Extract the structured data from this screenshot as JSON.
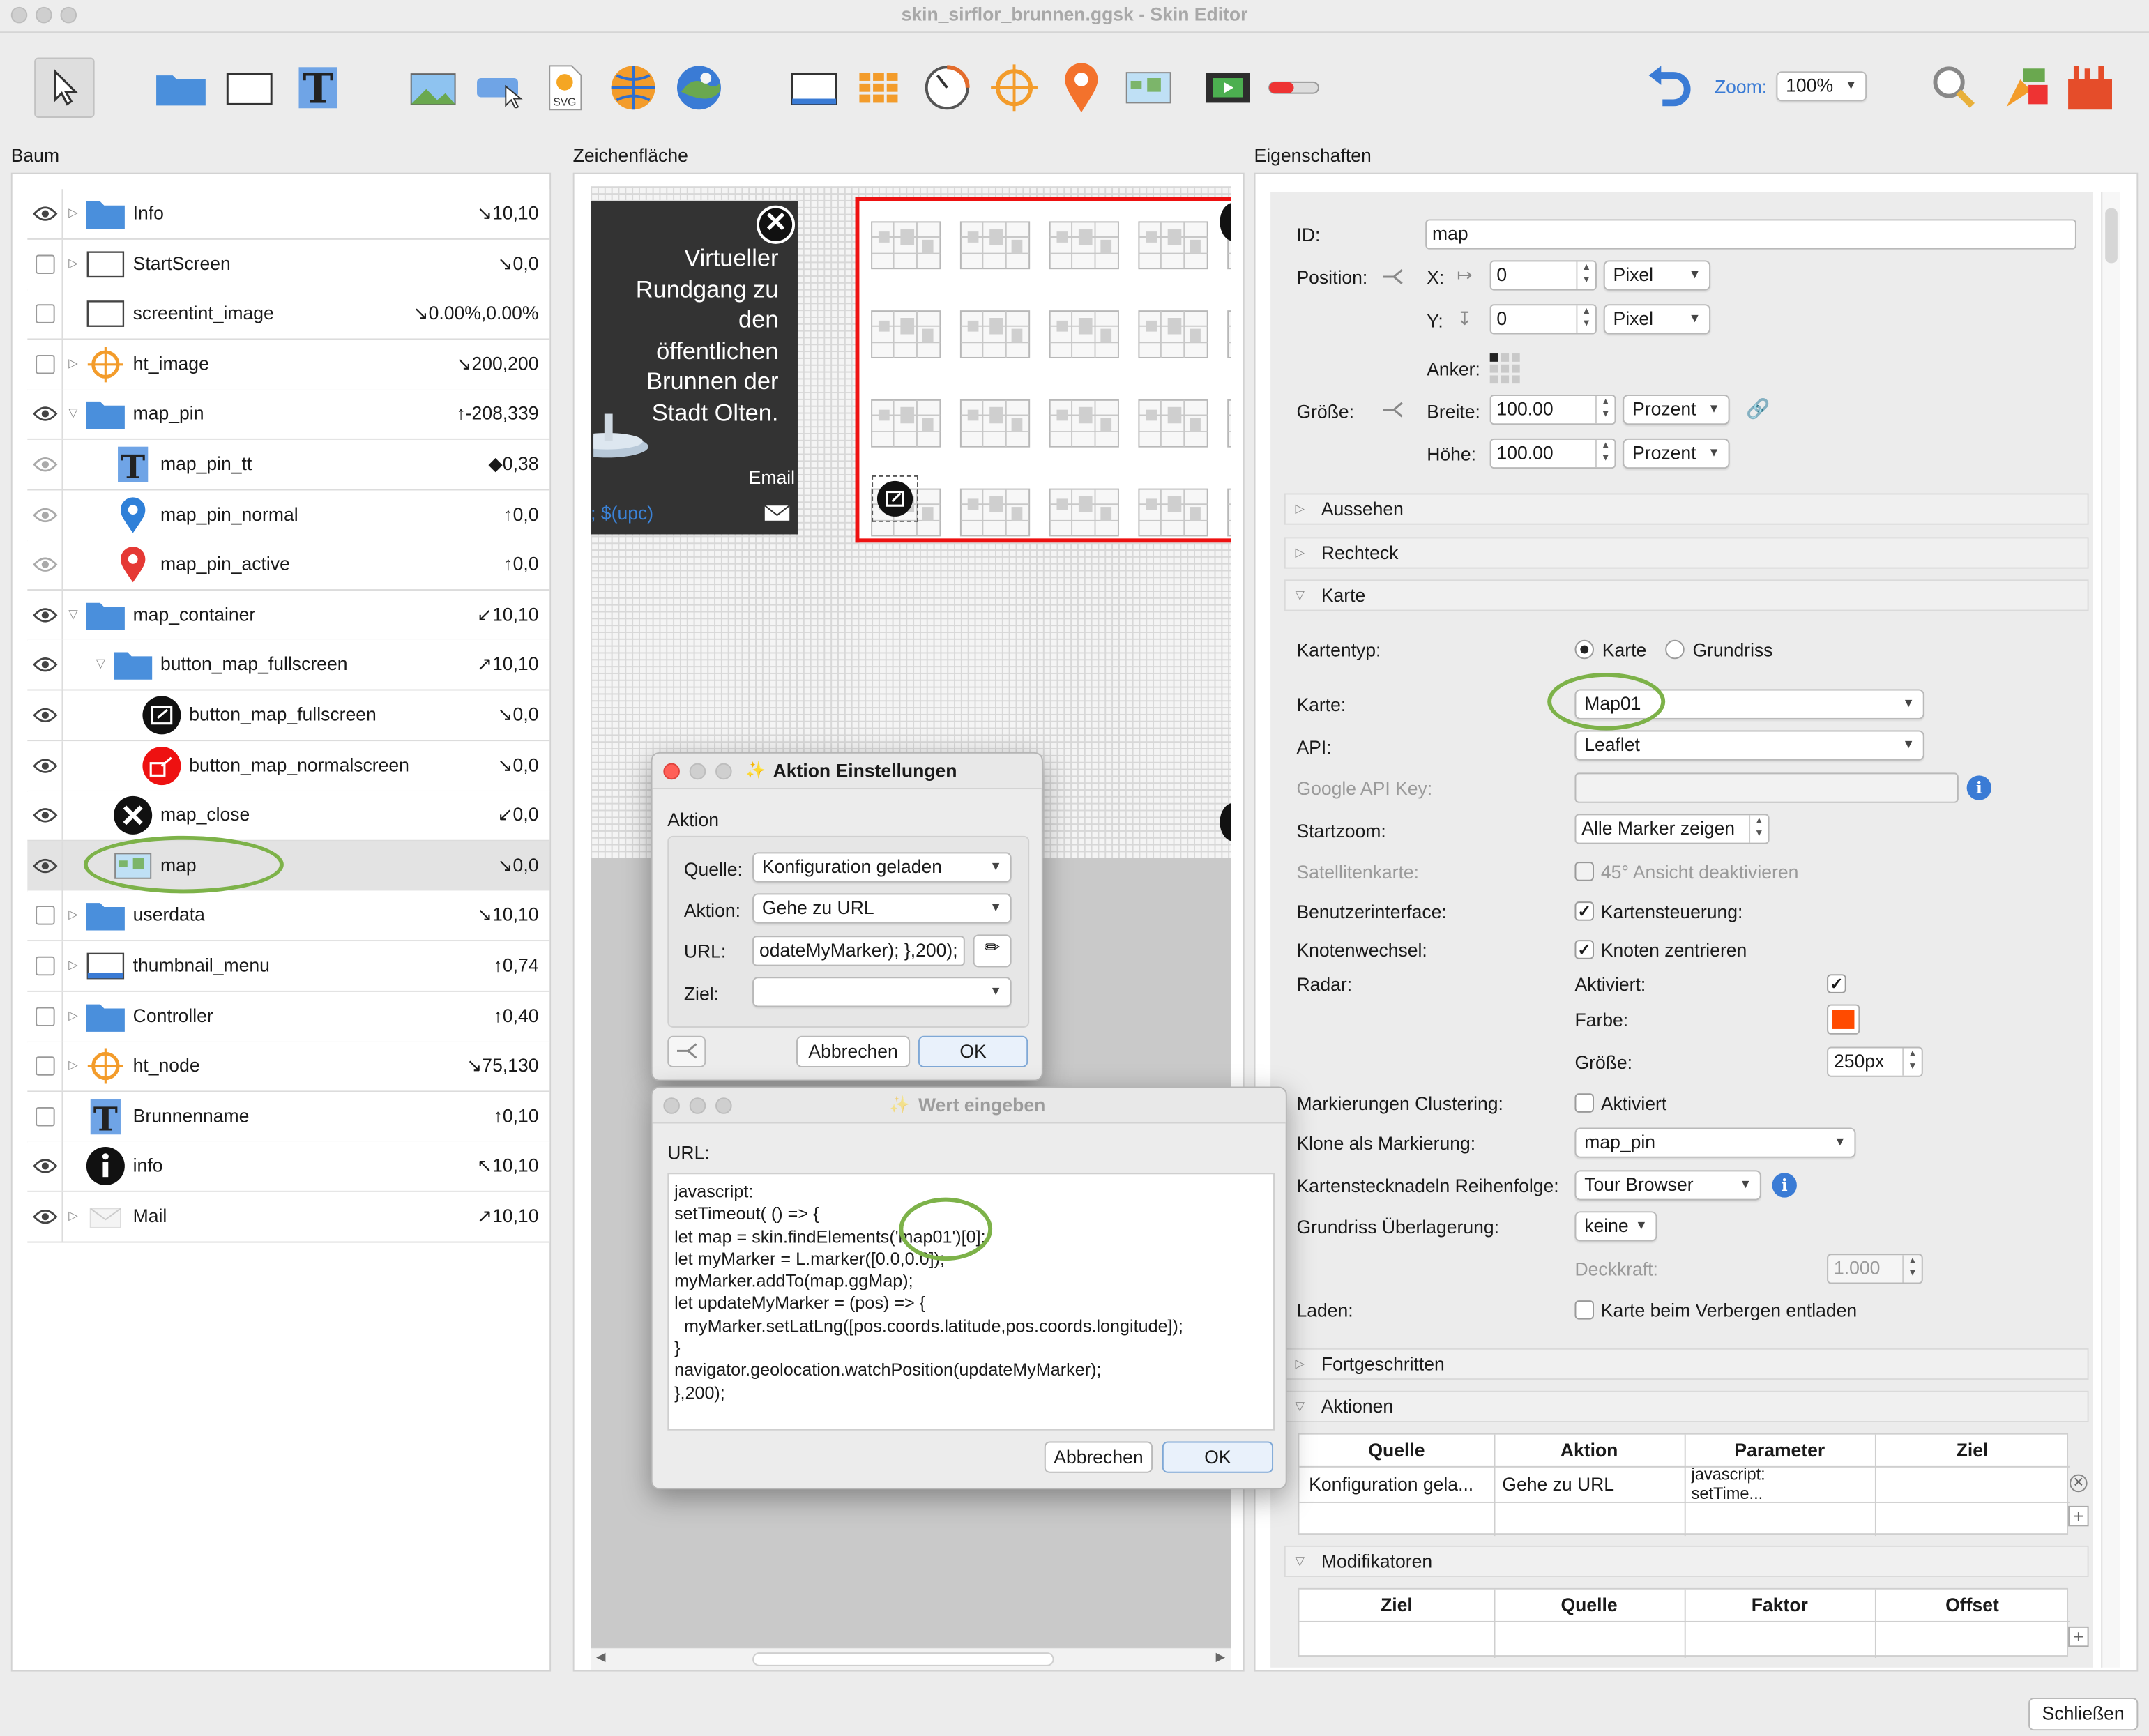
{
  "window": {
    "title": "skin_sirflor_brunnen.ggsk - Skin Editor"
  },
  "toolbar": {
    "zoom_label": "Zoom:",
    "zoom_value": "100%"
  },
  "panels": {
    "tree_title": "Baum",
    "canvas_title": "Zeichenfläche",
    "props_title": "Eigenschaften"
  },
  "tree": [
    {
      "label": "Info",
      "value": "↘10,10",
      "icon": "folder-icon"
    },
    {
      "label": "StartScreen",
      "value": "↘0,0",
      "icon": "rectangle-icon"
    },
    {
      "label": "screentint_image",
      "value": "↘0.00%,0.00%",
      "icon": "rectangle-icon"
    },
    {
      "label": "ht_image",
      "value": "↘200,200",
      "icon": "crosshair-icon"
    },
    {
      "label": "map_pin",
      "value": "↑-208,339",
      "icon": "folder-icon"
    },
    {
      "label": "map_pin_tt",
      "value": "◆0,38",
      "icon": "text-icon"
    },
    {
      "label": "map_pin_normal",
      "value": "↑0,0",
      "icon": "pin-blue-icon"
    },
    {
      "label": "map_pin_active",
      "value": "↑0,0",
      "icon": "pin-red-icon"
    },
    {
      "label": "map_container",
      "value": "↙10,10",
      "icon": "folder-icon"
    },
    {
      "label": "button_map_fullscreen",
      "value": "↗10,10",
      "icon": "folder-icon"
    },
    {
      "label": "button_map_fullscreen",
      "value": "↘0,0",
      "icon": "fullscreen-icon"
    },
    {
      "label": "button_map_normalscreen",
      "value": "↘0,0",
      "icon": "normalscreen-icon"
    },
    {
      "label": "map_close",
      "value": "↙0,0",
      "icon": "close-icon"
    },
    {
      "label": "map",
      "value": "↘0,0",
      "icon": "map-icon"
    },
    {
      "label": "userdata",
      "value": "↘10,10",
      "icon": "folder-icon"
    },
    {
      "label": "thumbnail_menu",
      "value": "↑0,74",
      "icon": "thumbnail-icon"
    },
    {
      "label": "Controller",
      "value": "↑0,40",
      "icon": "folder-icon"
    },
    {
      "label": "ht_node",
      "value": "↘75,130",
      "icon": "crosshair-icon"
    },
    {
      "label": "Brunnenname",
      "value": "↑0,10",
      "icon": "text-icon"
    },
    {
      "label": "info",
      "value": "↖10,10",
      "icon": "info-icon"
    },
    {
      "label": "Mail",
      "value": "↗10,10",
      "icon": "mail-icon"
    }
  ],
  "canvas": {
    "panel_text": "Virtueller Rundgang zu den öffentlichen Brunnen der Stadt Olten.",
    "email_label": "Email",
    "upc_text": "; $(upc)"
  },
  "props": {
    "id_label": "ID:",
    "id_value": "map",
    "position_label": "Position:",
    "x_label": "X:",
    "x_value": "0",
    "y_label": "Y:",
    "y_value": "0",
    "pixel_unit": "Pixel",
    "anchor_label": "Anker:",
    "size_label": "Größe:",
    "width_label": "Breite:",
    "width_value": "100.00",
    "height_label": "Höhe:",
    "height_value": "100.00",
    "percent_unit": "Prozent",
    "sections": {
      "aussehen": "Aussehen",
      "rechteck": "Rechteck",
      "karte": "Karte",
      "fortgeschritten": "Fortgeschritten",
      "aktionen": "Aktionen",
      "modifikatoren": "Modifikatoren"
    },
    "map_type_label": "Kartentyp:",
    "map_type_map": "Karte",
    "map_type_floorplan": "Grundriss",
    "map_label": "Karte:",
    "map_value": "Map01",
    "api_label": "API:",
    "api_value": "Leaflet",
    "google_key_label": "Google API Key:",
    "startzoom_label": "Startzoom:",
    "startzoom_value": "Alle Marker zeigen",
    "satellite_label": "Satellitenkarte:",
    "satellite_option": "45° Ansicht deaktivieren",
    "ui_label": "Benutzerinterface:",
    "ui_option": "Kartensteuerung:",
    "node_change_label": "Knotenwechsel:",
    "node_change_option": "Knoten zentrieren",
    "radar_label": "Radar:",
    "radar_active": "Aktiviert:",
    "radar_color": "Farbe:",
    "radar_size": "Größe:",
    "radar_size_value": "250px",
    "radar_color_hex": "#ff4b00",
    "clustering_label": "Markierungen Clustering:",
    "clustering_option": "Aktiviert",
    "clone_label": "Klone als Markierung:",
    "clone_value": "map_pin",
    "order_label": "Kartenstecknadeln Reihenfolge:",
    "order_value": "Tour Browser",
    "overlay_label": "Grundriss Überlagerung:",
    "overlay_value": "keine",
    "opacity_label": "Deckkraft:",
    "opacity_value": "1.000",
    "load_label": "Laden:",
    "load_option": "Karte beim Verbergen entladen",
    "actions_table": {
      "headers": [
        "Quelle",
        "Aktion",
        "Parameter",
        "Ziel"
      ],
      "row": [
        "Konfiguration gela...",
        "Gehe zu URL",
        "javascript:\nsetTime...",
        ""
      ]
    },
    "modifiers_table": {
      "headers": [
        "Ziel",
        "Quelle",
        "Faktor",
        "Offset"
      ]
    }
  },
  "dialog_action": {
    "title": "Aktion Einstellungen",
    "group": "Aktion",
    "source_label": "Quelle:",
    "source_value": "Konfiguration geladen",
    "action_label": "Aktion:",
    "action_value": "Gehe zu URL",
    "url_label": "URL:",
    "url_value": "odateMyMarker); },200);",
    "target_label": "Ziel:",
    "target_value": "",
    "cancel": "Abbrechen",
    "ok": "OK"
  },
  "dialog_value": {
    "title": "Wert eingeben",
    "url_label": "URL:",
    "code_lines": [
      "javascript:",
      "setTimeout( () => {",
      "let map = skin.findElements('map01')[0];",
      "let myMarker = L.marker([0.0,0.0]);",
      "myMarker.addTo(map.ggMap);",
      "let updateMyMarker = (pos) => {",
      "  myMarker.setLatLng([pos.coords.latitude,pos.coords.longitude]);",
      "}",
      "navigator.geolocation.watchPosition(updateMyMarker);",
      "},200);"
    ],
    "cancel": "Abbrechen",
    "ok": "OK"
  },
  "footer": {
    "close_label": "Schließen"
  }
}
